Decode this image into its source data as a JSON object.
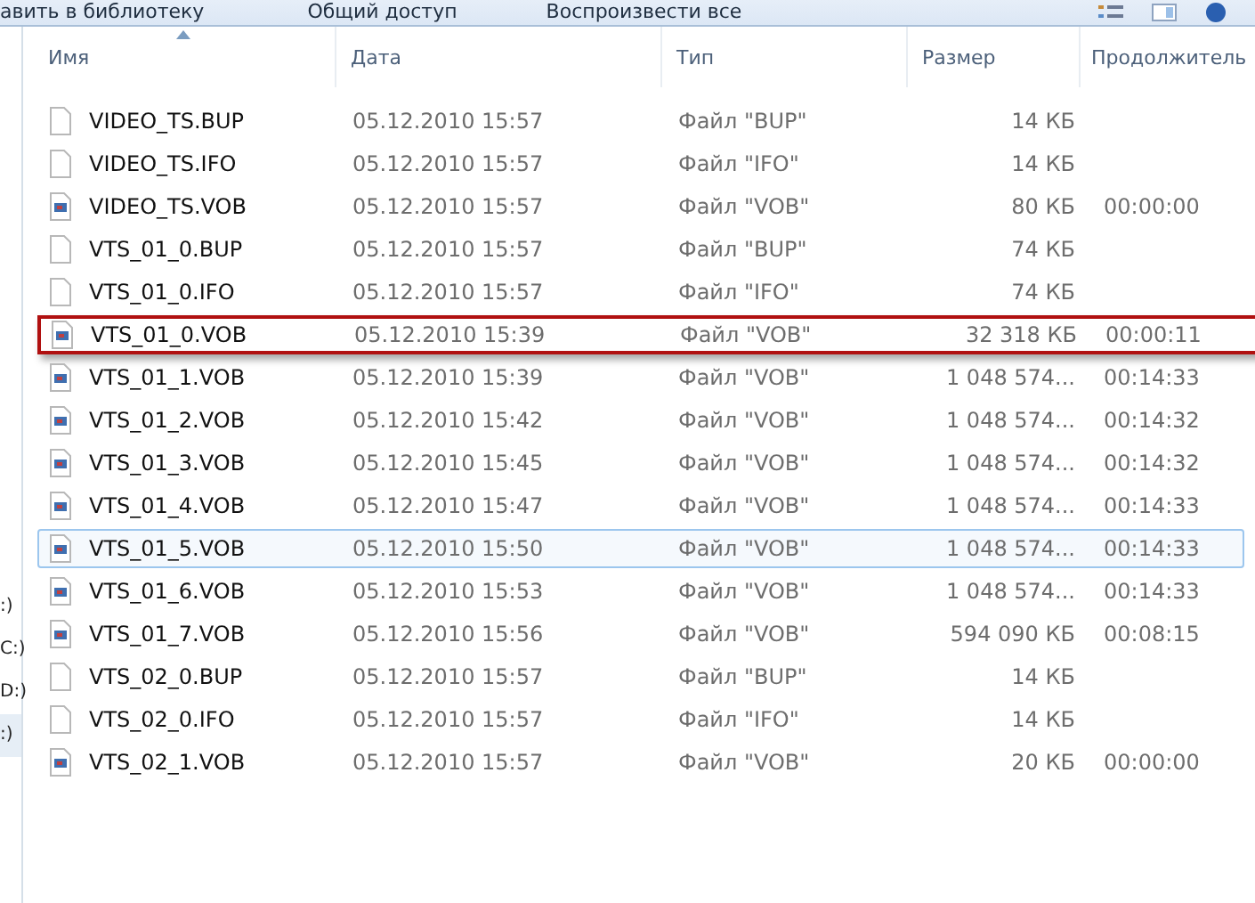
{
  "toolbar": {
    "items": [
      "авить в библиотеку",
      "Общий доступ",
      "Воспроизвести все"
    ]
  },
  "nav_pane": {
    "items": [
      {
        "label": ":)",
        "selected": false
      },
      {
        "label": "C:)",
        "selected": false
      },
      {
        "label": "D:)",
        "selected": false
      },
      {
        "label": ":)",
        "selected": true
      }
    ]
  },
  "table": {
    "columns": [
      {
        "label": "Имя",
        "sorted": true
      },
      {
        "label": "Дата",
        "sorted": false
      },
      {
        "label": "Тип",
        "sorted": false
      },
      {
        "label": "Размер",
        "sorted": false
      },
      {
        "label": "Продолжитель",
        "sorted": false
      }
    ],
    "rows": [
      {
        "kind": "blank",
        "name": "VIDEO_TS.BUP",
        "date": "05.12.2010 15:57",
        "type": "Файл \"BUP\"",
        "size": "14 КБ",
        "duration": "",
        "selected": false,
        "marked": false
      },
      {
        "kind": "blank",
        "name": "VIDEO_TS.IFO",
        "date": "05.12.2010 15:57",
        "type": "Файл \"IFO\"",
        "size": "14 КБ",
        "duration": "",
        "selected": false,
        "marked": false
      },
      {
        "kind": "video",
        "name": "VIDEO_TS.VOB",
        "date": "05.12.2010 15:57",
        "type": "Файл \"VOB\"",
        "size": "80 КБ",
        "duration": "00:00:00",
        "selected": false,
        "marked": false
      },
      {
        "kind": "blank",
        "name": "VTS_01_0.BUP",
        "date": "05.12.2010 15:57",
        "type": "Файл \"BUP\"",
        "size": "74 КБ",
        "duration": "",
        "selected": false,
        "marked": false
      },
      {
        "kind": "blank",
        "name": "VTS_01_0.IFO",
        "date": "05.12.2010 15:57",
        "type": "Файл \"IFO\"",
        "size": "74 КБ",
        "duration": "",
        "selected": false,
        "marked": false
      },
      {
        "kind": "video",
        "name": "VTS_01_0.VOB",
        "date": "05.12.2010 15:39",
        "type": "Файл \"VOB\"",
        "size": "32 318 КБ",
        "duration": "00:00:11",
        "selected": false,
        "marked": true
      },
      {
        "kind": "video",
        "name": "VTS_01_1.VOB",
        "date": "05.12.2010 15:39",
        "type": "Файл \"VOB\"",
        "size": "1 048 574...",
        "duration": "00:14:33",
        "selected": false,
        "marked": false
      },
      {
        "kind": "video",
        "name": "VTS_01_2.VOB",
        "date": "05.12.2010 15:42",
        "type": "Файл \"VOB\"",
        "size": "1 048 574...",
        "duration": "00:14:32",
        "selected": false,
        "marked": false
      },
      {
        "kind": "video",
        "name": "VTS_01_3.VOB",
        "date": "05.12.2010 15:45",
        "type": "Файл \"VOB\"",
        "size": "1 048 574...",
        "duration": "00:14:32",
        "selected": false,
        "marked": false
      },
      {
        "kind": "video",
        "name": "VTS_01_4.VOB",
        "date": "05.12.2010 15:47",
        "type": "Файл \"VOB\"",
        "size": "1 048 574...",
        "duration": "00:14:33",
        "selected": false,
        "marked": false
      },
      {
        "kind": "video",
        "name": "VTS_01_5.VOB",
        "date": "05.12.2010 15:50",
        "type": "Файл \"VOB\"",
        "size": "1 048 574...",
        "duration": "00:14:33",
        "selected": true,
        "marked": false
      },
      {
        "kind": "video",
        "name": "VTS_01_6.VOB",
        "date": "05.12.2010 15:53",
        "type": "Файл \"VOB\"",
        "size": "1 048 574...",
        "duration": "00:14:33",
        "selected": false,
        "marked": false
      },
      {
        "kind": "video",
        "name": "VTS_01_7.VOB",
        "date": "05.12.2010 15:56",
        "type": "Файл \"VOB\"",
        "size": "594 090 КБ",
        "duration": "00:08:15",
        "selected": false,
        "marked": false
      },
      {
        "kind": "blank",
        "name": "VTS_02_0.BUP",
        "date": "05.12.2010 15:57",
        "type": "Файл \"BUP\"",
        "size": "14 КБ",
        "duration": "",
        "selected": false,
        "marked": false
      },
      {
        "kind": "blank",
        "name": "VTS_02_0.IFO",
        "date": "05.12.2010 15:57",
        "type": "Файл \"IFO\"",
        "size": "14 КБ",
        "duration": "",
        "selected": false,
        "marked": false
      },
      {
        "kind": "video",
        "name": "VTS_02_1.VOB",
        "date": "05.12.2010 15:57",
        "type": "Файл \"VOB\"",
        "size": "20 КБ",
        "duration": "00:00:00",
        "selected": false,
        "marked": false
      }
    ]
  }
}
